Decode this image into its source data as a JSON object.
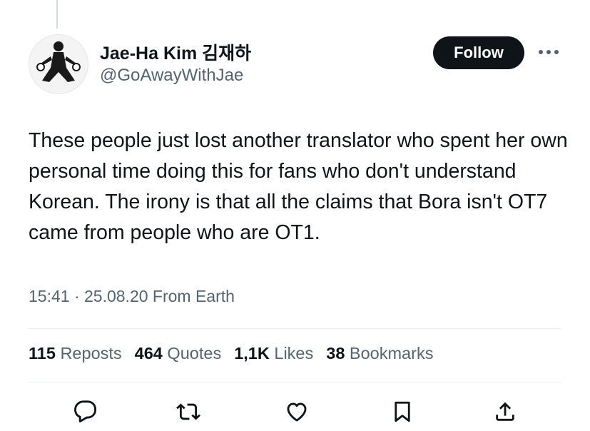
{
  "author": {
    "display_name": "Jae-Ha Kim 김재하",
    "handle": "@GoAwayWithJae",
    "avatar_icon": "profile-photo"
  },
  "follow_label": "Follow",
  "more_icon": "ellipsis-icon",
  "tweet": {
    "text": "These people just lost another translator who spent her own personal time doing this for fans who don't understand Korean. The irony is that all the claims that Bora isn't OT7 came from people who are OT1.",
    "meta": "15:41 · 25.08.20 From Earth"
  },
  "stats": {
    "reposts": {
      "count": "115",
      "label": "Reposts"
    },
    "quotes": {
      "count": "464",
      "label": "Quotes"
    },
    "likes": {
      "count": "1,1K",
      "label": "Likes"
    },
    "bookmarks": {
      "count": "38",
      "label": "Bookmarks"
    }
  },
  "actions": [
    "reply-icon",
    "repost-icon",
    "like-icon",
    "bookmark-icon",
    "share-icon"
  ],
  "colors": {
    "text": "#0f1419",
    "secondary": "#536471",
    "follow_bg": "#0f1419",
    "divider": "#e6ecf0"
  }
}
